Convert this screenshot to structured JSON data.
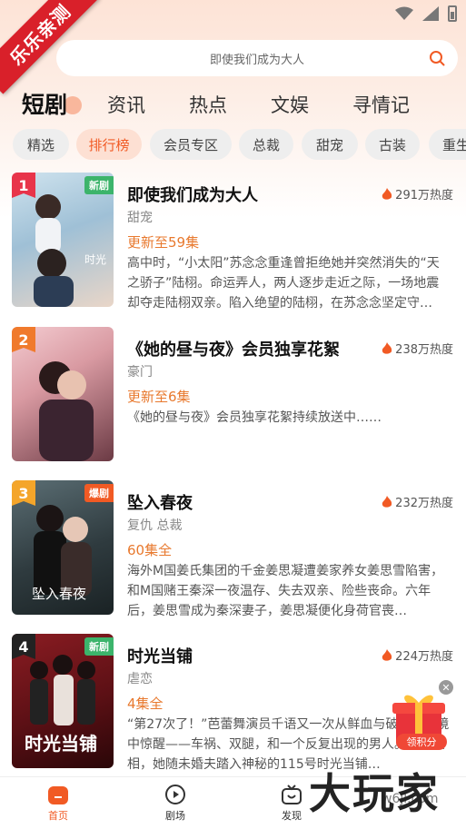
{
  "ribbon": "乐乐亲测",
  "search": {
    "placeholder_text": "即使我们成为大人"
  },
  "category_tabs": [
    "短剧",
    "资讯",
    "热点",
    "文娱",
    "寻情记"
  ],
  "filters": [
    "精选",
    "排行榜",
    "会员专区",
    "总裁",
    "甜宠",
    "古装",
    "重生"
  ],
  "items": [
    {
      "rank": "1",
      "badge": "新剧",
      "title": "即使我们成为大人",
      "heat": "291万热度",
      "genre": "甜宠",
      "episodes": "更新至59集",
      "desc": "高中时，“小太阳”苏念念重逢曾拒绝她并突然消失的“天之骄子”陆栩。命运弄人，两人逐步走近之际，一场地震却夺走陆栩双亲。陷入绝望的陆栩，在苏念念坚定守…",
      "colors": {
        "rank_bg": "#e8344a",
        "badge_bg": "#3cb46b"
      }
    },
    {
      "rank": "2",
      "badge": "",
      "title": "《她的昼与夜》会员独享花絮",
      "heat": "238万热度",
      "genre": "豪门",
      "episodes": "更新至6集",
      "desc": "《她的昼与夜》会员独享花絮持续放送中……",
      "colors": {
        "rank_bg": "#f07a2c",
        "badge_bg": ""
      }
    },
    {
      "rank": "3",
      "badge": "爆剧",
      "title": "坠入春夜",
      "heat": "232万热度",
      "genre": "复仇 总裁",
      "episodes": "60集全",
      "desc": "海外M国姜氏集团的千金姜思凝遭姜家养女姜思雪陷害，和M国赌王秦深一夜温存、失去双亲、险些丧命。六年后，姜思雪成为秦深妻子，姜思凝便化身荷官喪…",
      "colors": {
        "rank_bg": "#f4a52a",
        "badge_bg": "#f15a24"
      }
    },
    {
      "rank": "4",
      "badge": "新剧",
      "title": "时光当铺",
      "heat": "224万热度",
      "genre": "虐恋",
      "episodes": "4集全",
      "desc": "“第27次了！”芭蕾舞演员千语又一次从鲜血与破碎的梦境中惊醒——车祸、双腿，和一个反复出现的男人。为寻真相，她随未婚夫踏入神秘的115号时光当铺…",
      "colors": {
        "rank_bg": "#222222",
        "badge_bg": "#3cb46b"
      }
    }
  ],
  "bottom_nav": [
    {
      "label": "首页",
      "icon": "home-icon",
      "active": true
    },
    {
      "label": "剧场",
      "icon": "theater-icon",
      "active": false
    },
    {
      "label": "发现",
      "icon": "discover-tv-icon",
      "active": false
    }
  ],
  "gift": {
    "label": "领积分",
    "close": "✕"
  },
  "watermark": {
    "text": "大玩家",
    "sub": "w6jl.com"
  },
  "colors": {
    "accent": "#f15a24",
    "episode": "#e8792e"
  }
}
